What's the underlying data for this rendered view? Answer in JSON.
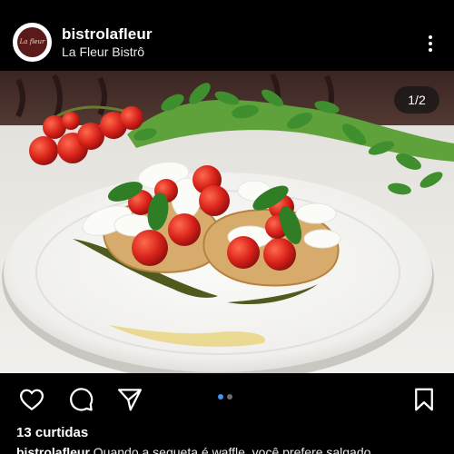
{
  "post": {
    "username": "bistrolafleur",
    "subtitle": "La Fleur Bistrô",
    "avatar_text": "La fleur",
    "image_counter": "1/2",
    "carousel": {
      "total": 2,
      "active": 1
    },
    "likes": "13 curtidas",
    "caption_user": "bistrolafleur",
    "caption_text": " Quando a sequeta é waffle, você prefere salgado..."
  },
  "icons": {
    "more": "more-vertical-icon",
    "like": "heart-icon",
    "comment": "comment-icon",
    "share": "send-icon",
    "save": "bookmark-icon"
  },
  "colors": {
    "background": "#000000",
    "carousel_active": "#3897f0",
    "carousel_inactive": "#6b6b6b",
    "avatar_brand": "#5b1a1a"
  }
}
